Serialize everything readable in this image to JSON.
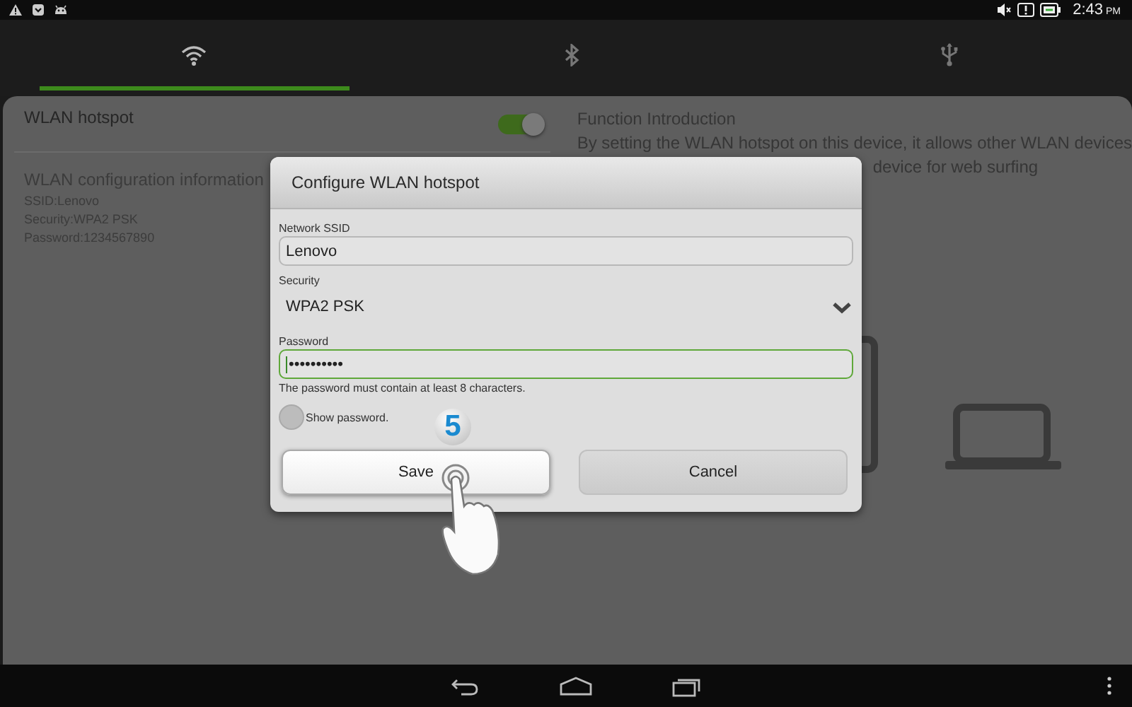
{
  "status_bar": {
    "time": "2:43",
    "meridiem": "PM"
  },
  "tabs": [
    {
      "kind": "wifi",
      "selected": true
    },
    {
      "kind": "bluetooth",
      "selected": false
    },
    {
      "kind": "usb",
      "selected": false
    }
  ],
  "hotspot": {
    "label": "WLAN hotspot",
    "on": true
  },
  "config_info": {
    "title": "WLAN configuration information",
    "lines": [
      "SSID:Lenovo",
      "Security:WPA2 PSK",
      "Password:1234567890"
    ]
  },
  "intro": {
    "title": "Function Introduction",
    "lines": [
      "By setting the WLAN hotspot on this device, it allows other WLAN devices",
      "device for web surfing"
    ]
  },
  "dialog": {
    "title": "Configure WLAN hotspot",
    "fields": [
      {
        "kind": "text",
        "label": "Network SSID",
        "value": "Lenovo",
        "focused": false
      },
      {
        "kind": "select",
        "label": "Security",
        "value": "WPA2 PSK"
      },
      {
        "kind": "text",
        "label": "Password",
        "value": "••••••••••",
        "focused": true
      }
    ],
    "hint": "The password must contain at least 8 characters.",
    "show_password": {
      "label": "Show password.",
      "checked": false
    },
    "buttons": [
      {
        "label": "Save",
        "highlighted": true
      },
      {
        "label": "Cancel",
        "highlighted": false
      }
    ]
  },
  "step_badge": "5"
}
